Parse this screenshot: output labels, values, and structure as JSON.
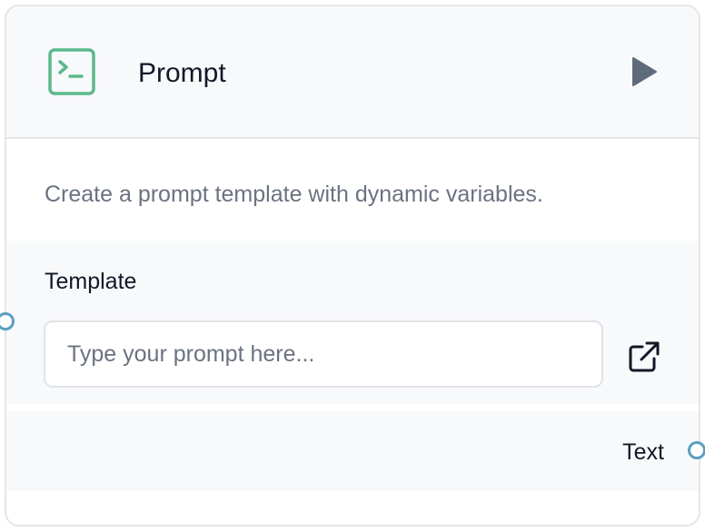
{
  "node": {
    "title": "Prompt",
    "description": "Create a prompt template with dynamic variables.",
    "icon": "terminal-icon",
    "run_icon": "play-icon"
  },
  "template": {
    "label": "Template",
    "placeholder": "Type your prompt here...",
    "value": "",
    "expand_icon": "external-link-icon"
  },
  "output": {
    "label": "Text"
  },
  "colors": {
    "icon_accent": "#5bb98b",
    "run_button": "#5f6a7d",
    "handle": "#5b9ec2",
    "header_bg": "#f8f9fb"
  }
}
